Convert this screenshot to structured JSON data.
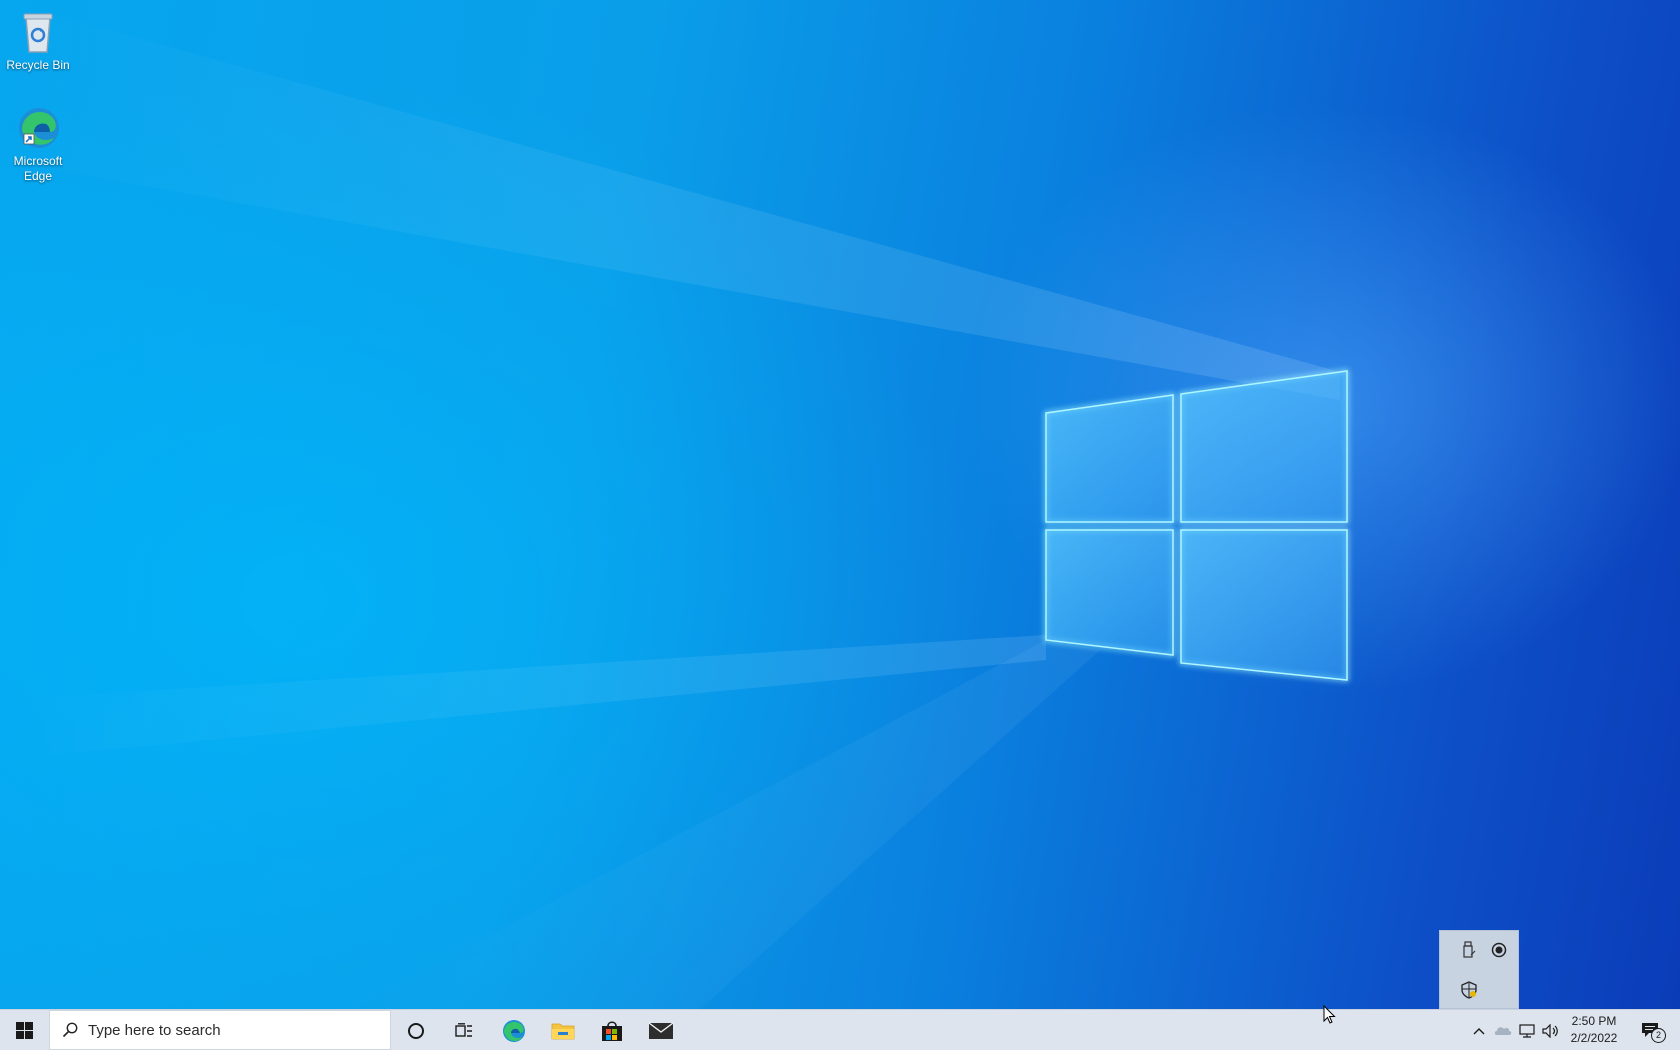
{
  "desktop": {
    "icons": [
      {
        "label": "Recycle Bin",
        "icon": "recycle-bin-icon"
      },
      {
        "label": "Microsoft Edge",
        "icon": "edge-icon"
      }
    ]
  },
  "taskbar": {
    "start_icon": "windows-logo-icon",
    "search": {
      "placeholder": "Type here to search",
      "icon": "search-icon"
    },
    "pinned": [
      {
        "name": "cortana",
        "icon": "cortana-circle-icon"
      },
      {
        "name": "task-view",
        "icon": "task-view-icon"
      },
      {
        "name": "edge",
        "icon": "edge-icon"
      },
      {
        "name": "file-explorer",
        "icon": "folder-icon"
      },
      {
        "name": "store",
        "icon": "store-bag-icon"
      },
      {
        "name": "mail",
        "icon": "mail-icon"
      }
    ],
    "tray": {
      "chevron_icon": "chevron-up-icon",
      "icons": [
        "cloud-icon",
        "network-icon",
        "volume-icon"
      ],
      "clock": {
        "time": "2:50 PM",
        "date": "2/2/2022"
      },
      "notifications": {
        "icon": "action-center-icon",
        "count": "2"
      }
    }
  },
  "tray_overflow": {
    "icons": [
      "usb-drive-icon",
      "record-icon",
      "security-shield-icon"
    ]
  },
  "colors": {
    "wallpaper_light": "#06a7ef",
    "wallpaper_dark": "#0b3cb8",
    "taskbar": "#dde4ee",
    "accent": "#0078d7"
  }
}
